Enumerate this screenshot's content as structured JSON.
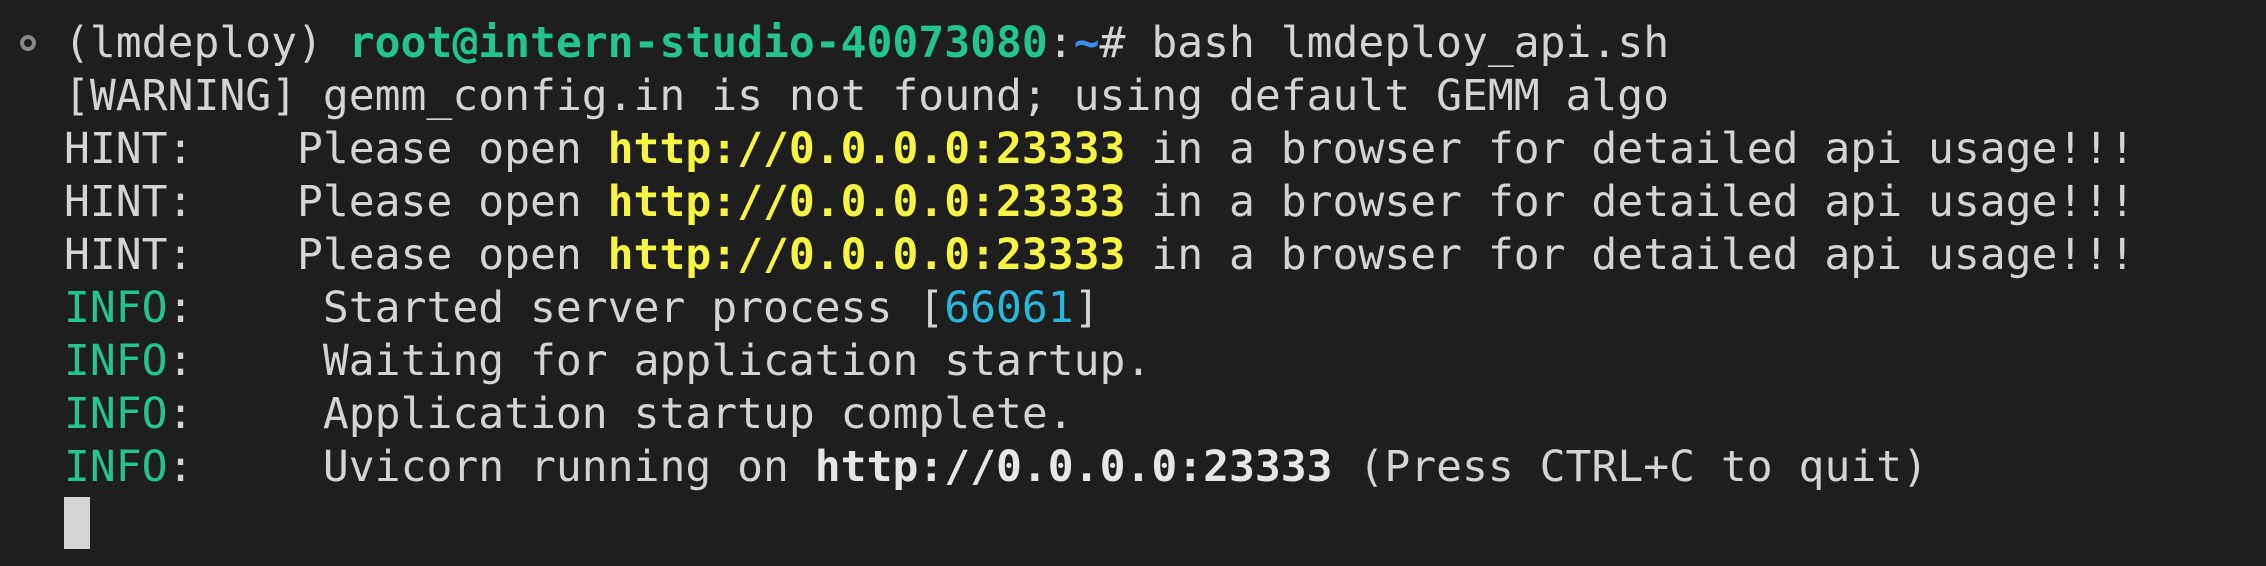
{
  "terminal": {
    "prompt": {
      "env": "(lmdeploy) ",
      "user_host": "root@intern-studio-40073080",
      "colon": ":",
      "path": "~",
      "symbol": "# ",
      "command": "bash lmdeploy_api.sh"
    },
    "warning_line": "[WARNING] gemm_config.in is not found; using default GEMM algo",
    "hints": [
      {
        "label": "HINT:    ",
        "before": "Please open ",
        "url": "http://0.0.0.0:23333",
        "after": " in a browser for detailed api usage!!!"
      },
      {
        "label": "HINT:    ",
        "before": "Please open ",
        "url": "http://0.0.0.0:23333",
        "after": " in a browser for detailed api usage!!!"
      },
      {
        "label": "HINT:    ",
        "before": "Please open ",
        "url": "http://0.0.0.0:23333",
        "after": " in a browser for detailed api usage!!!"
      }
    ],
    "info": {
      "label": "INFO",
      "sep": ":     ",
      "started_before": "Started server process [",
      "pid": "66061",
      "started_after": "]",
      "waiting": "Waiting for application startup.",
      "complete": "Application startup complete.",
      "uvicorn_before": "Uvicorn running on ",
      "uvicorn_url": "http://0.0.0.0:23333",
      "uvicorn_after": " (Press CTRL+C to quit)"
    },
    "colors": {
      "background": "#1e1e1e",
      "text": "#d4d4d4",
      "green": "#23c48e",
      "blue": "#3b8eea",
      "yellow": "#f5f543",
      "cyan": "#29b8db"
    }
  }
}
